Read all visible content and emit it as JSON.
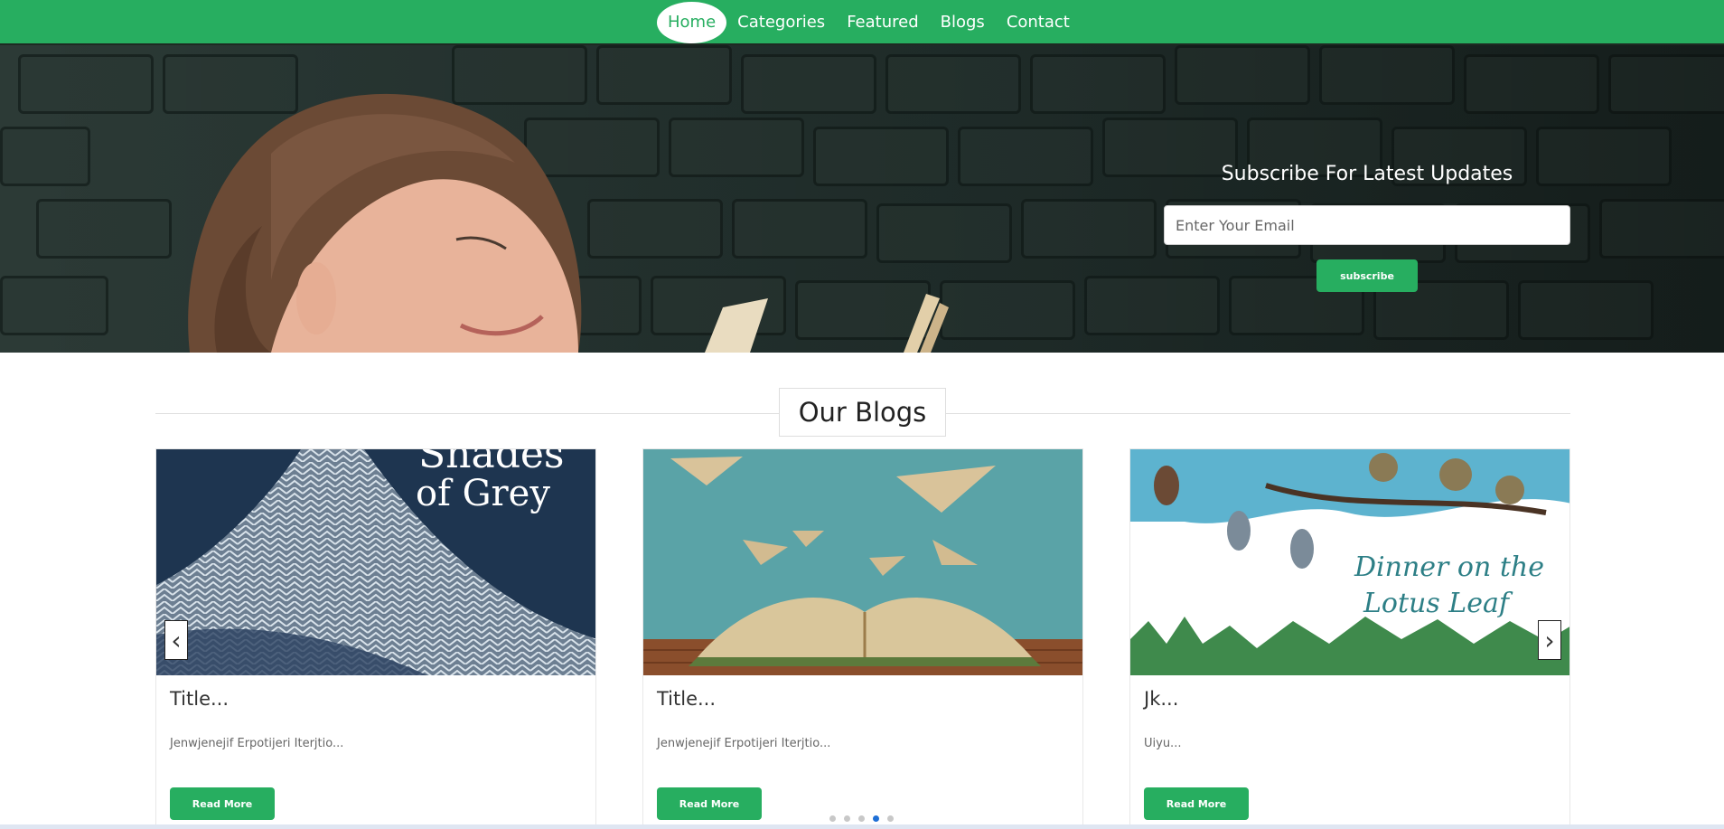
{
  "nav": {
    "items": [
      {
        "label": "Home",
        "active": true
      },
      {
        "label": "Categories",
        "active": false
      },
      {
        "label": "Featured",
        "active": false
      },
      {
        "label": "Blogs",
        "active": false
      },
      {
        "label": "Contact",
        "active": false
      }
    ]
  },
  "hero": {
    "subscribe_title": "Subscribe For Latest Updates",
    "email_placeholder": "Enter Your Email",
    "subscribe_label": "subscribe"
  },
  "blogs": {
    "heading": "Our Blogs",
    "cards": [
      {
        "image_text_1": "Shades",
        "image_text_2": "of Grey",
        "title": "Title...",
        "text": "Jenwjenejif Erpotijeri Iterjtio...",
        "button": "Read More"
      },
      {
        "title": "Title...",
        "text": "Jenwjenejif Erpotijeri Iterjtio...",
        "button": "Read More"
      },
      {
        "image_text_1": "Dinner on the",
        "image_text_2": "Lotus Leaf",
        "title": "Jk...",
        "text": "Uiyu...",
        "button": "Read More"
      }
    ],
    "carousel": {
      "dot_count": 5,
      "active_dot": 3,
      "prev_icon": "chevron-left-icon",
      "next_icon": "chevron-right-icon"
    }
  },
  "colors": {
    "accent": "#27ae60",
    "dot_active": "#1e6fd6"
  }
}
